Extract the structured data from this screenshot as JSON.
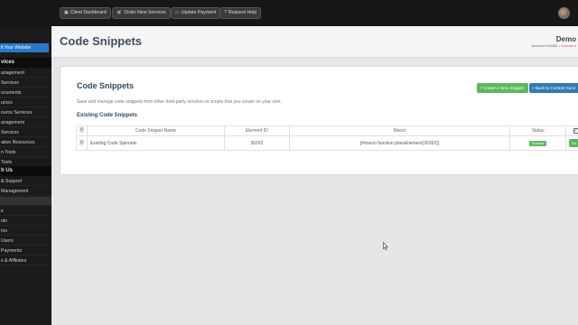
{
  "topbar": {
    "buttons": [
      {
        "icon": "dashboard-icon",
        "label": "Client Dashboard"
      },
      {
        "icon": "cart-icon",
        "label": "Order New Services"
      },
      {
        "icon": "card-icon",
        "label": "Update Payment"
      },
      {
        "icon": "help-icon",
        "label": "Request Help"
      }
    ]
  },
  "sidebar": {
    "visit_link": "it Your Website",
    "sections": [
      {
        "label": "vices",
        "items": [
          "anagement",
          "Services",
          "ocuments",
          "urces",
          "ource Services",
          "anagement",
          "Services",
          "ation Resources",
          "n Tools",
          "Tools"
        ]
      },
      {
        "label": "h Us",
        "items": [
          "& Support",
          "Management",
          "",
          "e",
          "nts",
          "ms",
          "Users",
          "Payments",
          "s & Affiliates"
        ]
      }
    ]
  },
  "header": {
    "title": "Code Snippets",
    "account_name": "Demo",
    "account_sub": "Account #15460 •",
    "account_status": "Choose a"
  },
  "card": {
    "title": "Code Snippets",
    "description": "Save and manage code snippets from other third-party services or scripts that you create on your own.",
    "subtitle": "Existing Code Snippets",
    "create_button": "+ Create a New Snippet",
    "back_button": "« Back to Content Servi"
  },
  "table": {
    "headers": [
      "Code Snippet Name",
      "Element ID",
      "Macro",
      "Status"
    ],
    "rows": [
      {
        "name": "Existing Code Spinnets",
        "element_id": "36262",
        "macro": "[#macro function placeElement(36262)]",
        "status": "Enabled",
        "action": "Sa"
      }
    ]
  }
}
